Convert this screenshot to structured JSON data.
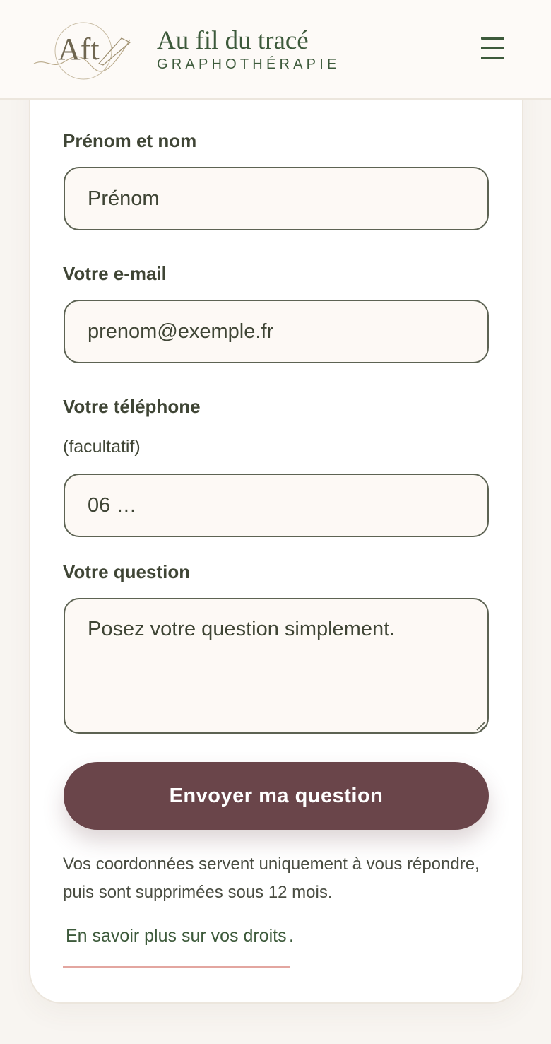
{
  "header": {
    "logo_monogram": "Aft",
    "title": "Au fil du tracé",
    "subtitle": "GRAPHOTHÉRAPIE",
    "menu_icon": "hamburger-icon"
  },
  "form": {
    "name": {
      "label": "Prénom et nom",
      "placeholder": "Prénom",
      "value": ""
    },
    "email": {
      "label": "Votre e-mail",
      "placeholder": "prenom@exemple.fr",
      "value": ""
    },
    "phone": {
      "label": "Votre téléphone",
      "note": "(facultatif)",
      "placeholder": "06 …",
      "value": ""
    },
    "question": {
      "label": "Votre question",
      "placeholder": "Posez votre question simplement.",
      "value": ""
    },
    "submit_label": "Envoyer ma question"
  },
  "privacy": {
    "text": "Vos coordonnées servent uniquement à vous répondre, puis sont supprimées sous 12 mois.",
    "link_label": "En savoir plus sur vos droits",
    "link_suffix": "."
  },
  "colors": {
    "brand_green": "#3d5a3b",
    "button_plum": "#6a454a",
    "link_underline": "#e3a6a0",
    "page_background": "#f8f5f1"
  }
}
